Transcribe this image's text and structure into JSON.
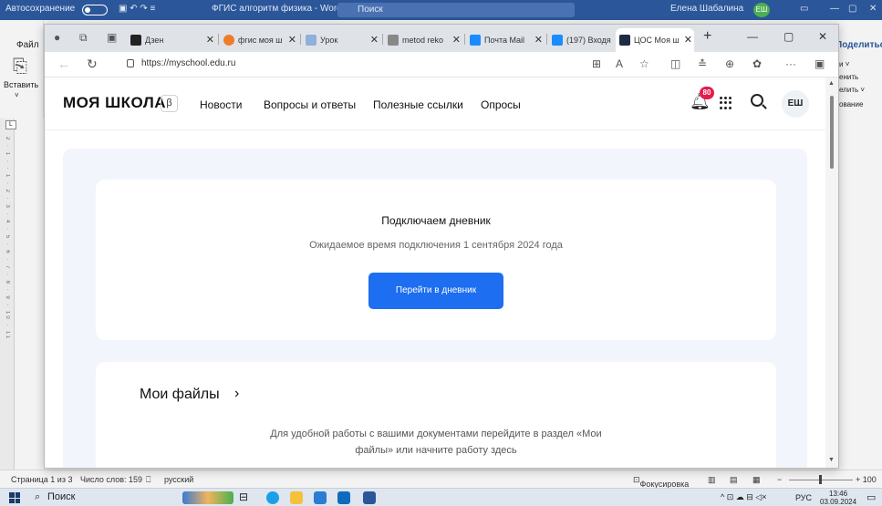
{
  "word": {
    "autosave": "Автосохранение",
    "doc_title": "ФГИС алгоритм физика - Word",
    "search": "Поиск",
    "user": "Елена Шабалина",
    "user_initials": "ЕШ",
    "file_tab": "Файл",
    "paste": "Вставить",
    "share": "Поделиться",
    "ribbon_right_1": "и ˅",
    "ribbon_right_2": "енить",
    "ribbon_right_3": "елить ˅",
    "ribbon_right_4": "ование",
    "ruler_marker": "L",
    "ruler_ticks": "2 · 1 · · 1 · 2 · 3 · 4 · 5 · 6 · 7 · 8 · 9 · 10 · 11",
    "status": {
      "page": "Страница 1 из 3",
      "words": "Число слов: 159",
      "lang": "русский",
      "focus": "Фокусировка",
      "zoom_end": "+ 100"
    }
  },
  "taskbar": {
    "search": "Поиск",
    "lang": "РУС",
    "time": "13:46",
    "date": "03.09.2024"
  },
  "browser": {
    "tabs": [
      {
        "label": "Дзен",
        "color": "#222222"
      },
      {
        "label": "фгис моя ш",
        "color": "#f07b2a"
      },
      {
        "label": "Урок",
        "color": "#8fb0d8"
      },
      {
        "label": "metod reko",
        "color": "#888888"
      },
      {
        "label": "Почта Mail",
        "color": "#1a8cff"
      },
      {
        "label": "(197) Входя",
        "color": "#1a8cff"
      },
      {
        "label": "ЦОС Моя ш",
        "color": "#1f2a44"
      }
    ],
    "url": "https://myschool.edu.ru"
  },
  "site": {
    "logo": "МОЯ ШКОЛА",
    "beta": "β",
    "nav": [
      "Новости",
      "Вопросы и ответы",
      "Полезные ссылки",
      "Опросы"
    ],
    "notifications_count": "80",
    "user_initials": "ЕШ",
    "diary": {
      "title": "Подключаем дневник",
      "subtitle": "Ожидаемое время подключения 1 сентября 2024 года",
      "button": "Перейти в дневник"
    },
    "files": {
      "title": "Мои файлы",
      "text": "Для удобной работы с вашими документами перейдите в раздел «Мои файлы» или начните работу здесь"
    }
  },
  "colors": {
    "accent": "#1d6ef0",
    "badge": "#e6194b",
    "word_blue": "#2b579a"
  }
}
